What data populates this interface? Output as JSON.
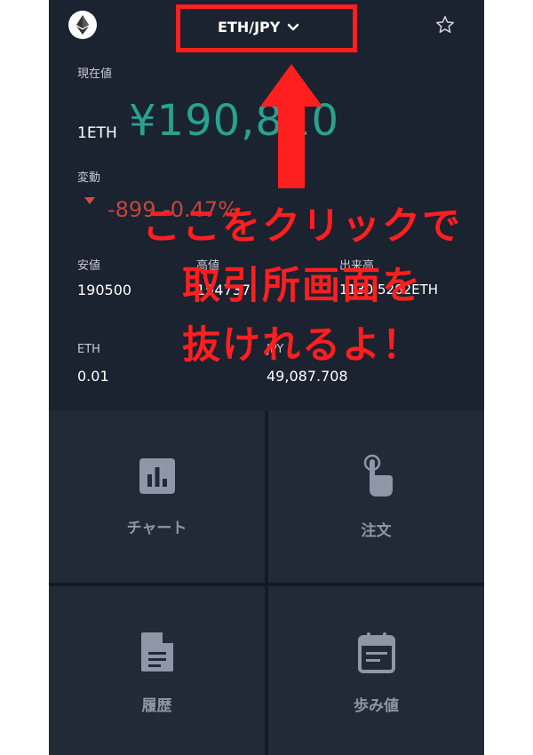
{
  "header": {
    "pair": "ETH/JPY"
  },
  "price": {
    "label": "現在値",
    "unit": "1ETH",
    "value": "¥190,810"
  },
  "change": {
    "label": "変動",
    "value": "-899 -0.47%"
  },
  "stats": {
    "low_label": "安値",
    "low_value": "190500",
    "high_label": "高値",
    "high_value": "194737",
    "volume_label": "出来高",
    "volume_value": "1130.5262ETH"
  },
  "balances": {
    "eth_label": "ETH",
    "eth_value": "0.01",
    "jpy_label": "JPY",
    "jpy_value": "49,087.708"
  },
  "menu": {
    "chart": "チャート",
    "order": "注文",
    "history": "履歴",
    "trades": "歩み値"
  },
  "annotation": {
    "line1": "ここをクリックで",
    "line2": "取引所画面を",
    "line3": "抜けれるよ！"
  },
  "colors": {
    "background": "#1b2230",
    "price_green": "#27a38f",
    "change_red": "#c0483a",
    "annotation_red": "#ff1f1f"
  },
  "icons": [
    "ethereum-logo-icon",
    "chevron-down-icon",
    "star-icon",
    "bar-chart-icon",
    "tap-hand-icon",
    "document-icon",
    "calendar-icon"
  ]
}
